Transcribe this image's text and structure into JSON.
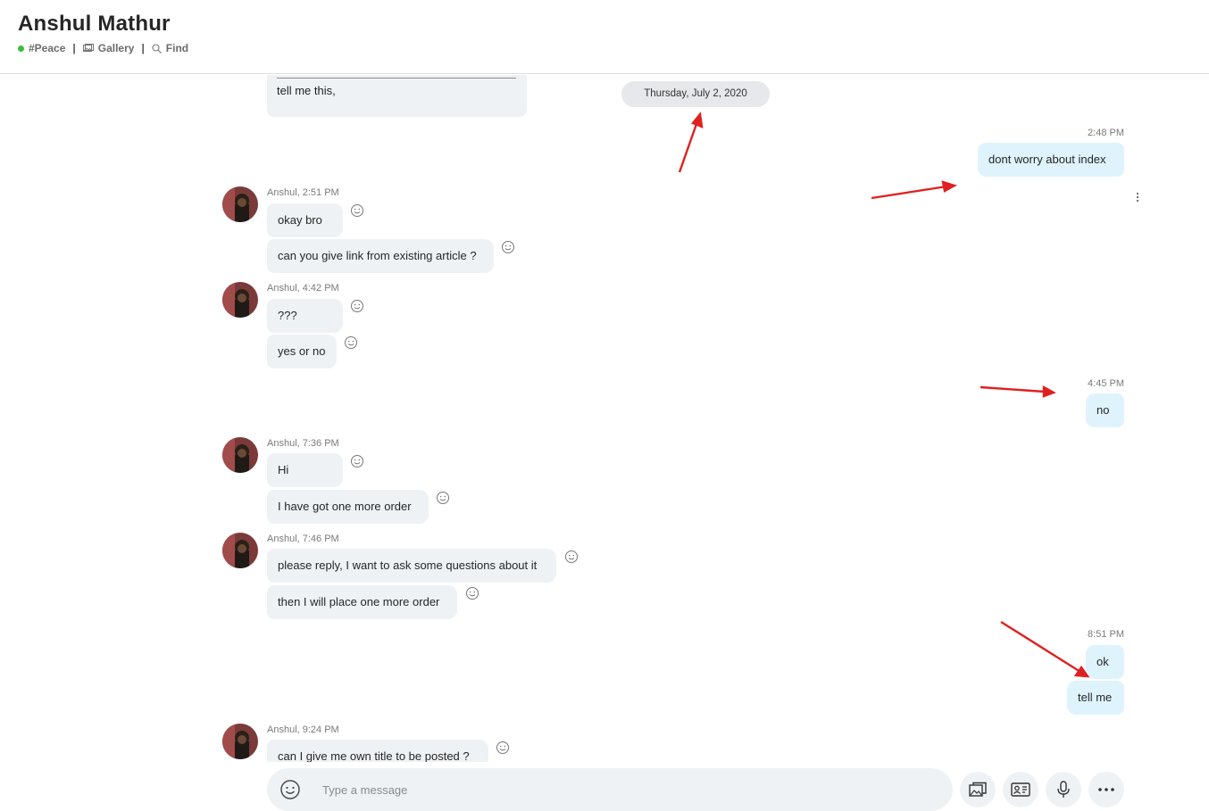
{
  "header": {
    "title": "Anshul Mathur",
    "status_label": "#Peace",
    "gallery_label": "Gallery",
    "find_label": "Find",
    "separator": "|"
  },
  "chat": {
    "previous_message": "tell me this,",
    "date_divider": "Thursday, July 2, 2020",
    "messages": [
      {
        "sender": "me",
        "time": "2:48 PM",
        "texts": [
          "dont worry about index"
        ]
      },
      {
        "sender": "Anshul",
        "meta": "Anshul, 2:51 PM",
        "texts": [
          "okay bro",
          "can you give link from existing article ?"
        ]
      },
      {
        "sender": "Anshul",
        "meta": "Anshul, 4:42 PM",
        "texts": [
          "???",
          "yes or no"
        ]
      },
      {
        "sender": "me",
        "time": "4:45 PM",
        "texts": [
          "no"
        ]
      },
      {
        "sender": "Anshul",
        "meta": "Anshul, 7:36 PM",
        "texts": [
          "Hi",
          "I have got one more order"
        ]
      },
      {
        "sender": "Anshul",
        "meta": "Anshul, 7:46 PM",
        "texts": [
          "please reply, I want to ask some questions about it",
          "then I will place one more order"
        ]
      },
      {
        "sender": "me",
        "time": "8:51 PM",
        "texts": [
          "ok",
          "tell me"
        ]
      },
      {
        "sender": "Anshul",
        "meta": "Anshul, 9:24 PM",
        "texts": [
          "can I give me own title to be posted ?"
        ]
      }
    ]
  },
  "composer": {
    "placeholder": "Type a message"
  },
  "icons": {
    "status": "online-dot-icon",
    "gallery": "gallery-icon",
    "find": "search-icon",
    "react": "smiley-icon",
    "more": "kebab-icon",
    "emoji": "emoji-icon",
    "media": "media-gallery-icon",
    "contact": "contact-card-icon",
    "mic": "microphone-icon",
    "more_actions": "more-dots-icon"
  },
  "colors": {
    "incoming_bubble": "#eff2f5",
    "outgoing_bubble": "#dff3fd",
    "online": "#3bbd3b",
    "annotation_arrow": "#e02020"
  }
}
